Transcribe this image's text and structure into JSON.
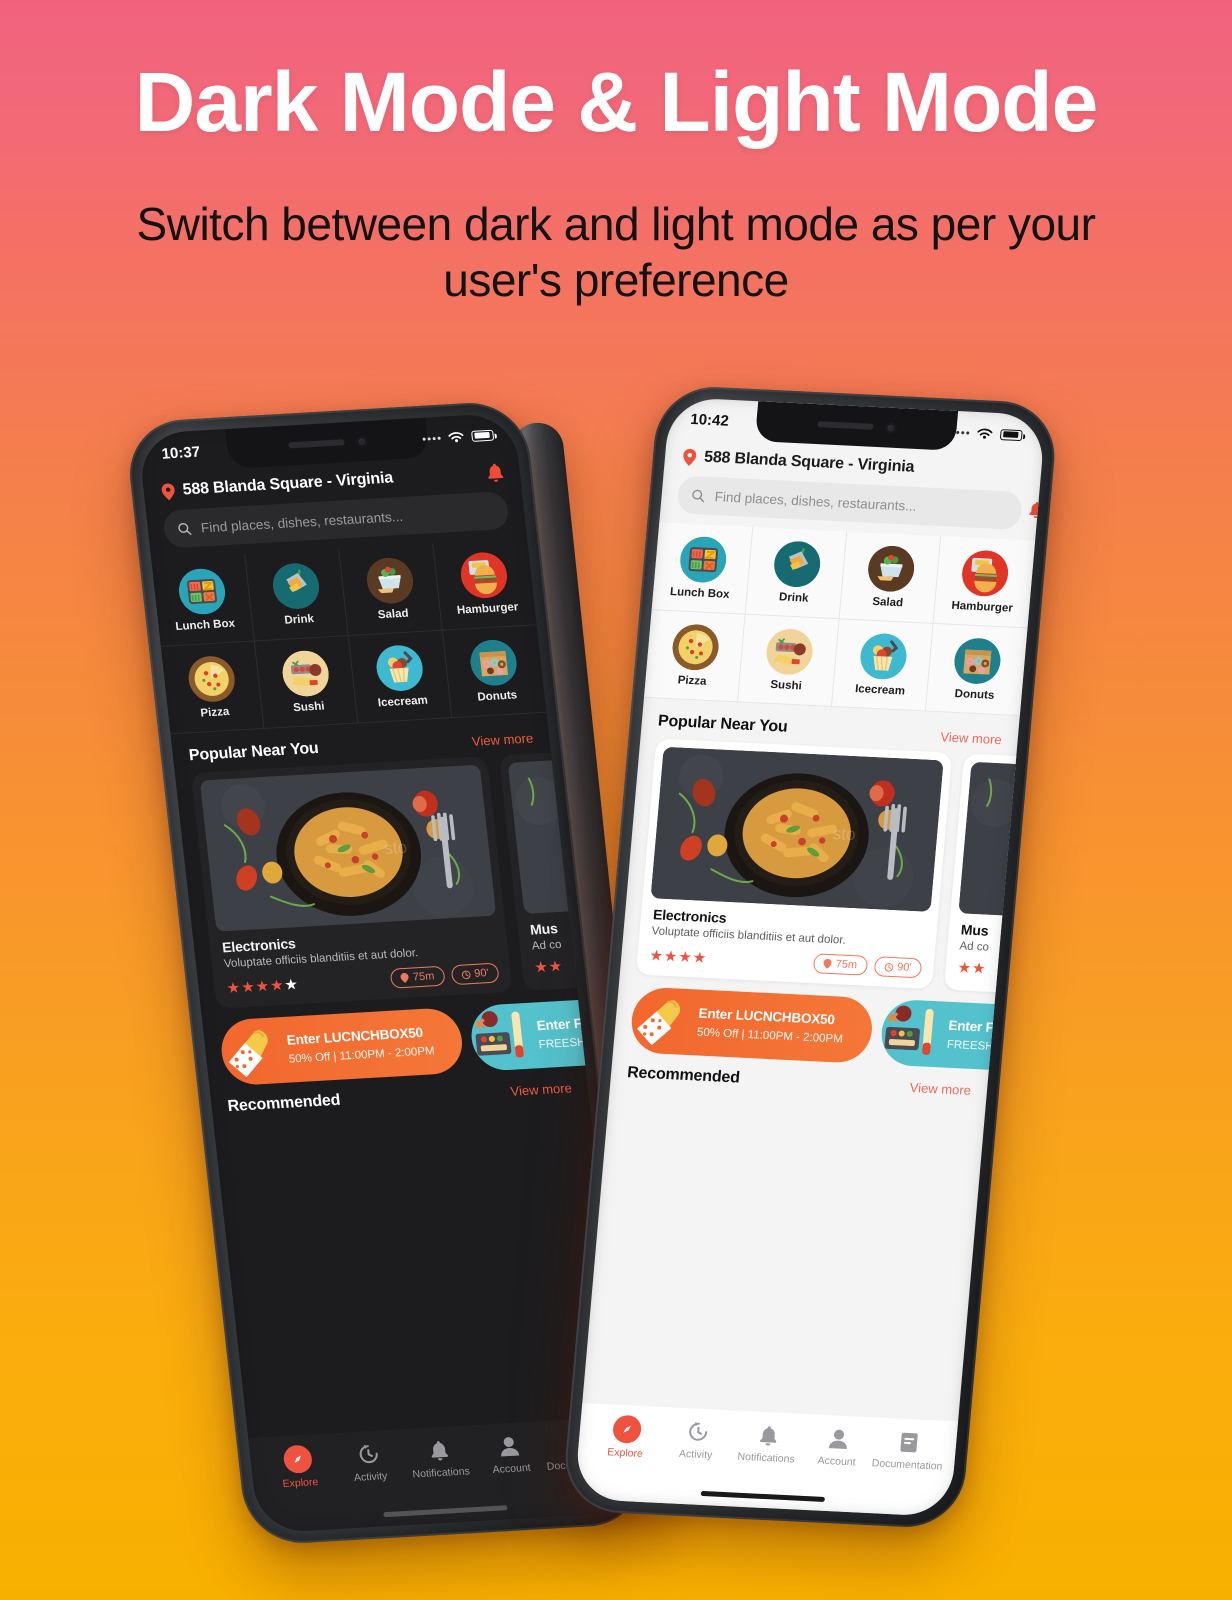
{
  "hero": {
    "title": "Dark Mode & Light Mode",
    "subtitle": "Switch between dark and light mode as per your user's preference"
  },
  "theme": {
    "bg_gradient_top": "#f2617c",
    "bg_gradient_bottom": "#f8b000",
    "accent": "#ef5340",
    "promo_orange": "#f2672e",
    "promo_teal": "#53c2cd",
    "dark_screen_bg": "#1c1c1e",
    "light_screen_bg": "#f4f4f4"
  },
  "phones": [
    {
      "mode": "dark",
      "status": {
        "time": "10:37",
        "wifi_icon": "wifi-icon",
        "battery_icon": "battery-icon"
      },
      "header": {
        "location_icon": "map-pin-icon",
        "address": "588 Blanda Square - Virginia",
        "bell_icon": "bell-icon"
      },
      "search": {
        "icon": "search-icon",
        "placeholder": "Find places, dishes, restaurants..."
      },
      "categories": [
        {
          "label": "Lunch Box",
          "icon": "lunchbox-icon"
        },
        {
          "label": "Drink",
          "icon": "drink-icon"
        },
        {
          "label": "Salad",
          "icon": "salad-icon"
        },
        {
          "label": "Hamburger",
          "icon": "hamburger-icon"
        },
        {
          "label": "Pizza",
          "icon": "pizza-icon"
        },
        {
          "label": "Sushi",
          "icon": "sushi-icon"
        },
        {
          "label": "Icecream",
          "icon": "icecream-icon"
        },
        {
          "label": "Donuts",
          "icon": "donuts-icon"
        }
      ],
      "popular": {
        "title": "Popular Near You",
        "view_more": "View more",
        "cards": [
          {
            "title": "Electronics",
            "description": "Voluptate officiis blanditiis et aut dolor.",
            "rating": 4,
            "rating_max": 5,
            "distance": "75m",
            "time": "90'",
            "distance_icon": "map-pin-icon",
            "time_icon": "clock-icon",
            "image": "pasta-bowl-photo"
          },
          {
            "title": "Mus",
            "description": "Ad co",
            "rating": 2,
            "rating_max": 5,
            "image": "pasta-bowl-photo"
          }
        ]
      },
      "promos": [
        {
          "line1": "Enter LUCNCHBOX50",
          "line2": "50% Off | 11:00PM - 2:00PM",
          "color": "orange",
          "art": "icecream-cone-art"
        },
        {
          "line1": "Enter F",
          "line2": "FREESHI",
          "color": "teal",
          "art": "bento-art"
        }
      ],
      "recommended": {
        "title": "Recommended",
        "view_more": "View more"
      },
      "tabs": [
        {
          "label": "Explore",
          "icon": "compass-icon",
          "active": true
        },
        {
          "label": "Activity",
          "icon": "history-icon",
          "active": false
        },
        {
          "label": "Notifications",
          "icon": "bell-icon",
          "active": false
        },
        {
          "label": "Account",
          "icon": "person-icon",
          "active": false
        },
        {
          "label": "Documentation",
          "icon": "document-icon",
          "active": false
        }
      ]
    },
    {
      "mode": "light",
      "status": {
        "time": "10:42",
        "wifi_icon": "wifi-icon",
        "battery_icon": "battery-icon"
      },
      "header": {
        "location_icon": "map-pin-icon",
        "address": "588 Blanda Square - Virginia",
        "bell_icon": "bell-icon"
      },
      "search": {
        "icon": "search-icon",
        "placeholder": "Find places, dishes, restaurants..."
      },
      "categories": [
        {
          "label": "Lunch Box",
          "icon": "lunchbox-icon"
        },
        {
          "label": "Drink",
          "icon": "drink-icon"
        },
        {
          "label": "Salad",
          "icon": "salad-icon"
        },
        {
          "label": "Hamburger",
          "icon": "hamburger-icon"
        },
        {
          "label": "Pizza",
          "icon": "pizza-icon"
        },
        {
          "label": "Sushi",
          "icon": "sushi-icon"
        },
        {
          "label": "Icecream",
          "icon": "icecream-icon"
        },
        {
          "label": "Donuts",
          "icon": "donuts-icon"
        }
      ],
      "popular": {
        "title": "Popular Near You",
        "view_more": "View more",
        "cards": [
          {
            "title": "Electronics",
            "description": "Voluptate officiis blanditiis et aut dolor.",
            "rating": 4,
            "rating_max": 4,
            "distance": "75m",
            "time": "90'",
            "distance_icon": "map-pin-icon",
            "time_icon": "clock-icon",
            "image": "pasta-bowl-photo"
          },
          {
            "title": "Mus",
            "description": "Ad co",
            "rating": 2,
            "rating_max": 5,
            "image": "pasta-bowl-photo"
          }
        ]
      },
      "promos": [
        {
          "line1": "Enter LUCNCHBOX50",
          "line2": "50% Off | 11:00PM - 2:00PM",
          "color": "orange",
          "art": "icecream-cone-art"
        },
        {
          "line1": "Enter F",
          "line2": "FREESHI",
          "color": "teal",
          "art": "bento-art"
        }
      ],
      "recommended": {
        "title": "Recommended",
        "view_more": "View more"
      },
      "tabs": [
        {
          "label": "Explore",
          "icon": "compass-icon",
          "active": true
        },
        {
          "label": "Activity",
          "icon": "history-icon",
          "active": false
        },
        {
          "label": "Notifications",
          "icon": "bell-icon",
          "active": false
        },
        {
          "label": "Account",
          "icon": "person-icon",
          "active": false
        },
        {
          "label": "Documentation",
          "icon": "document-icon",
          "active": false
        }
      ]
    }
  ]
}
